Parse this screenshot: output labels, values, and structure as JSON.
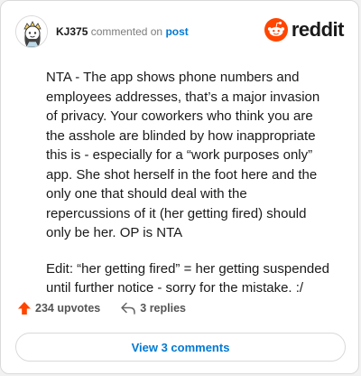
{
  "comment": {
    "username": "KJ375",
    "action_text": "commented on",
    "target_link": "post",
    "paragraphs": [
      "NTA - The app shows phone numbers and employees addresses, that’s a major invasion of privacy. Your coworkers who think you are the asshole are blinded by how inappropriate this is - especially for a “work purposes only” app. She shot herself in the foot here and the only one that should deal with the repercussions of it (her getting fired) should only be her. OP is NTA",
      "Edit: “her getting fired” = her getting suspended until further notice - sorry for the mistake. :/"
    ]
  },
  "brand": {
    "name": "reddit",
    "icon": "reddit-snoo-icon",
    "color": "#ff4500"
  },
  "footer": {
    "upvotes": "234 upvotes",
    "upvote_icon": "upvote-arrow-icon",
    "replies": "3 replies",
    "reply_icon": "reply-arrow-icon"
  },
  "view_button": {
    "label": "View 3 comments"
  },
  "colors": {
    "link": "#0079d3",
    "upvote": "#ff4500",
    "text": "#1a1a1b",
    "muted": "#7c7c7c"
  }
}
